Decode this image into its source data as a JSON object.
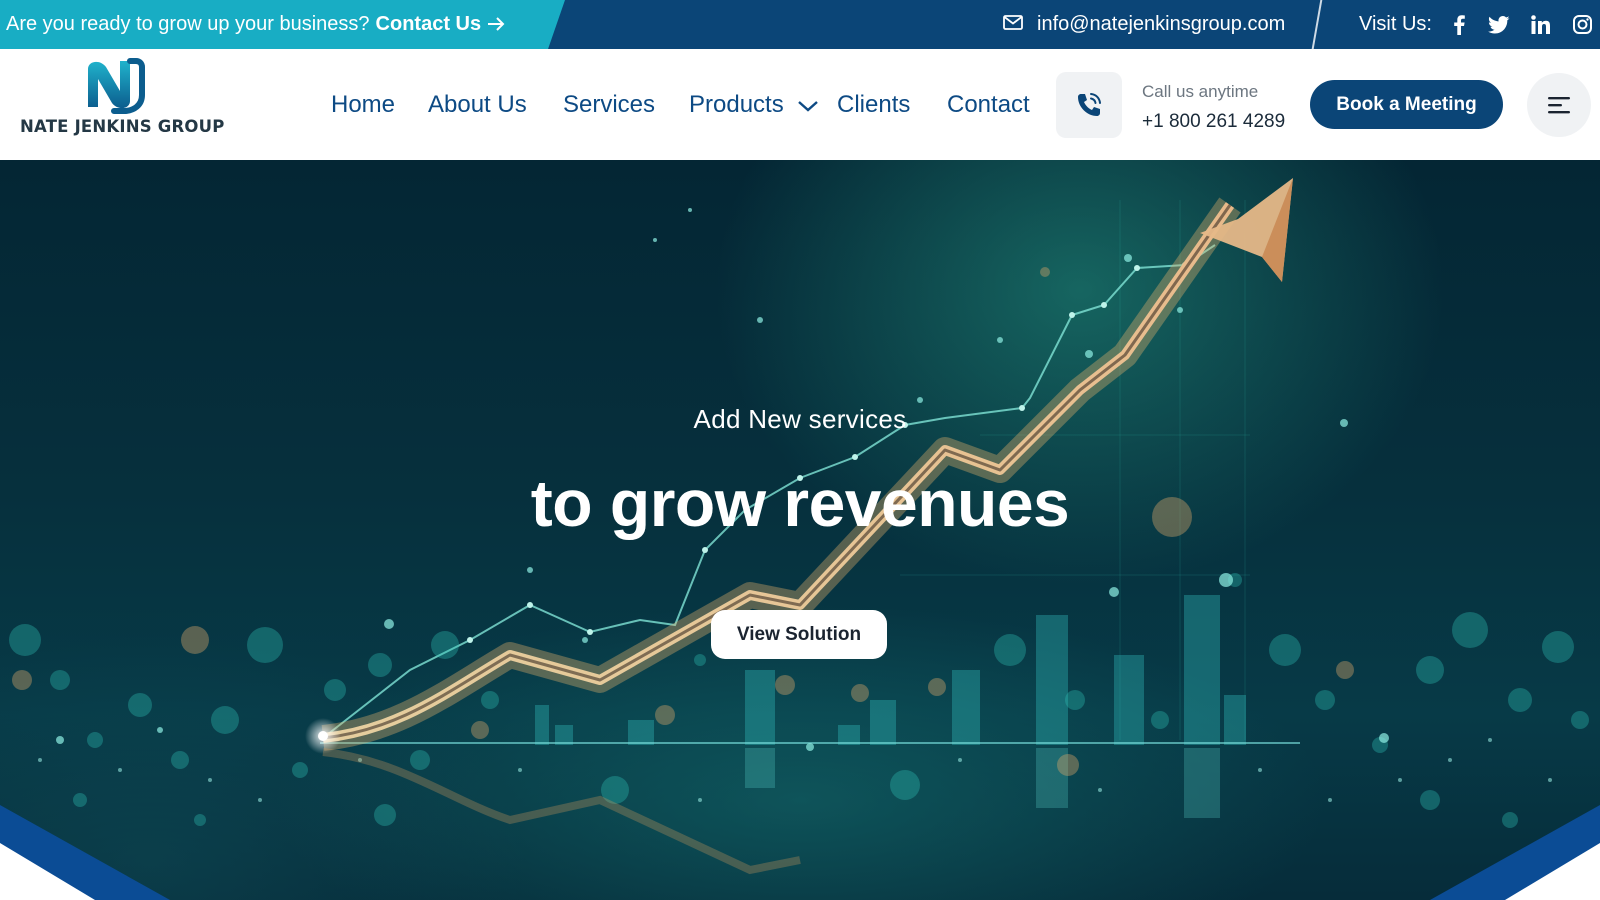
{
  "topbar": {
    "promo_text": "Are you ready to grow up your business?",
    "promo_cta": "Contact Us",
    "email": "info@natejenkinsgroup.com",
    "visit_label": "Visit Us:",
    "social_icons": [
      "facebook-icon",
      "twitter-icon",
      "linkedin-icon",
      "instagram-icon"
    ],
    "background": "#0b4577",
    "promo_background": "#18adc4"
  },
  "header": {
    "brand_name": "NATE JENKINS GROUP",
    "nav": {
      "home": "Home",
      "about": "About Us",
      "services": "Services",
      "products": "Products",
      "clients": "Clients",
      "contact": "Contact"
    },
    "call_label": "Call us anytime",
    "call_number": "+1 800 261 4289",
    "book_button": "Book a Meeting",
    "nav_color": "#0d4a84",
    "button_color": "#0b4577"
  },
  "hero": {
    "subtitle": "Add New services",
    "title": "to grow revenues",
    "button": "View Solution"
  }
}
